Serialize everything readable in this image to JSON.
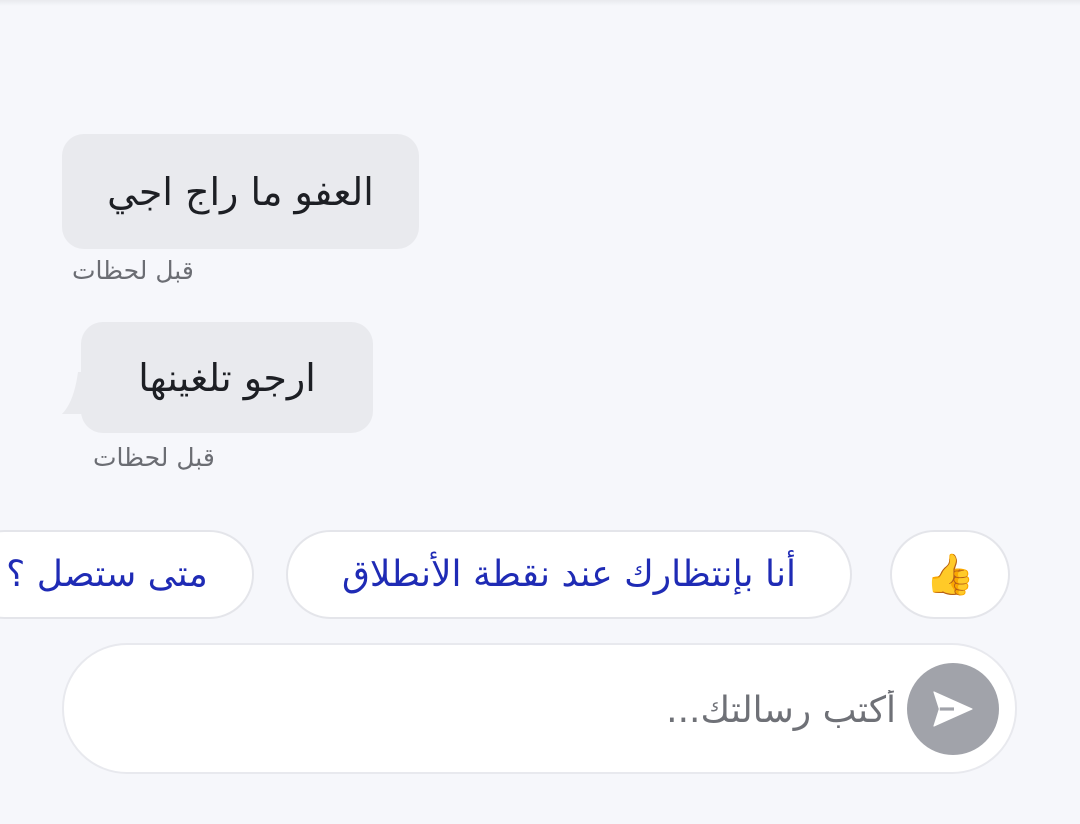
{
  "messages": [
    {
      "text": "العفو ما راج اجي",
      "time": "قبل لحظات"
    },
    {
      "text": "ارجو تلغينها",
      "time": "قبل لحظات"
    }
  ],
  "quick_replies": [
    {
      "label": "👍",
      "icon": "thumbs-up-icon"
    },
    {
      "label": "أنا بإنتظارك عند نقطة الأنطلاق"
    },
    {
      "label": "متى ستصل ؟"
    }
  ],
  "composer": {
    "placeholder": "أكتب رسالتك...",
    "value": "",
    "send_icon": "send-icon"
  },
  "colors": {
    "background": "#f6f7fb",
    "bubble": "#e9eaee",
    "chip_text": "#1f2bb5",
    "send_button": "#a1a3aa"
  }
}
